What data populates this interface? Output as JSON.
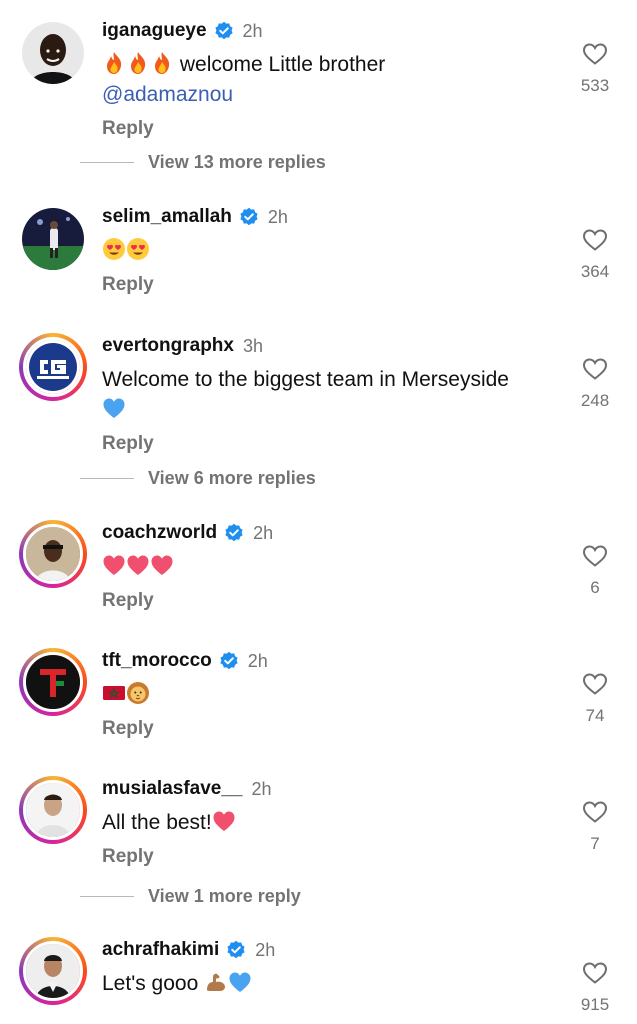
{
  "reply_label": "Reply",
  "colors": {
    "verified_badge": "#1f8ef1",
    "secondary_text": "#737373",
    "mention": "#3b5eb5",
    "story_ring": [
      "#f7b733",
      "#fc4a1a",
      "#d6249f",
      "#8a3ab9"
    ]
  },
  "icons": {
    "like": "heart-outline-icon",
    "verified": "verified-check-icon"
  },
  "comments": [
    {
      "username": "iganagueye",
      "verified": true,
      "time": "2h",
      "text": "welcome Little brother",
      "emojis_before": [
        "fire",
        "fire",
        "fire"
      ],
      "mention": "@adamaznou",
      "likes": "533",
      "view_more": "View 13 more replies"
    },
    {
      "username": "selim_amallah",
      "verified": true,
      "time": "2h",
      "text": "",
      "emojis": [
        "heart-eyes",
        "heart-eyes"
      ],
      "likes": "364"
    },
    {
      "username": "evertongraphx",
      "verified": false,
      "time": "3h",
      "text": "Welcome to the biggest team in Merseyside",
      "emojis_after": [
        "blue-heart"
      ],
      "likes": "248",
      "view_more": "View 6 more replies"
    },
    {
      "username": "coachzworld",
      "verified": true,
      "time": "2h",
      "text": "",
      "emojis": [
        "red-heart",
        "red-heart",
        "red-heart"
      ],
      "likes": "6"
    },
    {
      "username": "tft_morocco",
      "verified": true,
      "time": "2h",
      "text": "",
      "emojis": [
        "morocco-flag",
        "lion-face"
      ],
      "likes": "74"
    },
    {
      "username": "musialasfave__",
      "verified": false,
      "time": "2h",
      "text": "All the best!",
      "emojis_after": [
        "red-heart"
      ],
      "likes": "7",
      "view_more": "View 1 more reply"
    },
    {
      "username": "achrafhakimi",
      "verified": true,
      "time": "2h",
      "text": "Let's gooo",
      "emojis_after": [
        "flexed-biceps",
        "blue-heart"
      ],
      "likes": "915"
    }
  ]
}
